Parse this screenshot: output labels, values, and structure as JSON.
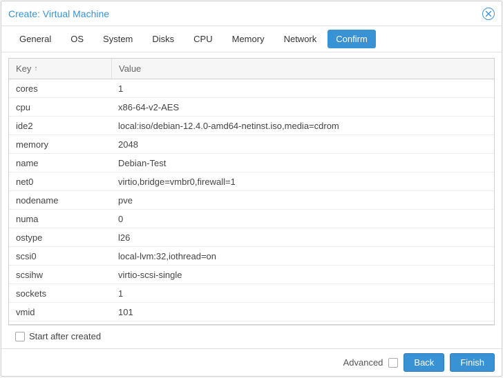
{
  "title": "Create: Virtual Machine",
  "tabs": {
    "general": "General",
    "os": "OS",
    "system": "System",
    "disks": "Disks",
    "cpu": "CPU",
    "memory": "Memory",
    "network": "Network",
    "confirm": "Confirm"
  },
  "columns": {
    "key": "Key",
    "value": "Value"
  },
  "rows": [
    {
      "key": "cores",
      "value": "1"
    },
    {
      "key": "cpu",
      "value": "x86-64-v2-AES"
    },
    {
      "key": "ide2",
      "value": "local:iso/debian-12.4.0-amd64-netinst.iso,media=cdrom"
    },
    {
      "key": "memory",
      "value": "2048"
    },
    {
      "key": "name",
      "value": "Debian-Test"
    },
    {
      "key": "net0",
      "value": "virtio,bridge=vmbr0,firewall=1"
    },
    {
      "key": "nodename",
      "value": "pve"
    },
    {
      "key": "numa",
      "value": "0"
    },
    {
      "key": "ostype",
      "value": "l26"
    },
    {
      "key": "scsi0",
      "value": "local-lvm:32,iothread=on"
    },
    {
      "key": "scsihw",
      "value": "virtio-scsi-single"
    },
    {
      "key": "sockets",
      "value": "1"
    },
    {
      "key": "vmid",
      "value": "101"
    }
  ],
  "startAfterCreated": "Start after created",
  "footer": {
    "advanced": "Advanced",
    "back": "Back",
    "finish": "Finish"
  }
}
